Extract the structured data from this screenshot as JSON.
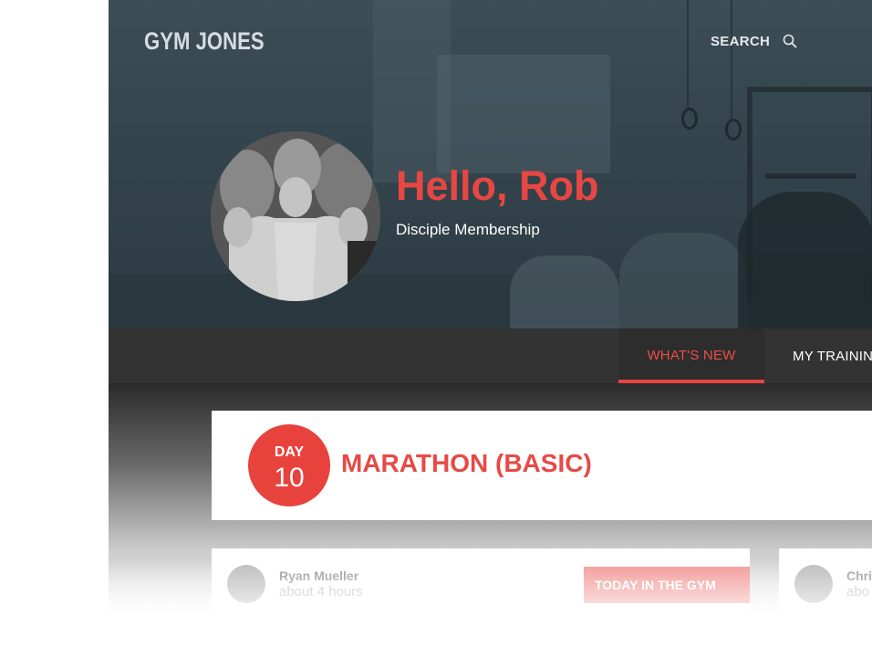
{
  "header": {
    "logo": "GYM JONES",
    "search_label": "SEARCH",
    "search_icon": "search-icon"
  },
  "profile": {
    "greeting": "Hello, Rob",
    "membership": "Disciple Membership"
  },
  "nav": {
    "tabs": [
      {
        "label": "WHAT'S NEW",
        "active": true
      },
      {
        "label": "MY TRAININ",
        "active": false
      }
    ]
  },
  "workout": {
    "day_label": "DAY",
    "day_number": "10",
    "title": "MARATHON (BASIC)"
  },
  "posts": [
    {
      "author": "Ryan Mueller",
      "time": "about 4 hours",
      "tag": "TODAY IN THE GYM"
    },
    {
      "author": "Chri",
      "time": "abo"
    }
  ],
  "colors": {
    "accent": "#e74742",
    "hero_bg": "#34444d",
    "nav_bg": "#333333"
  }
}
